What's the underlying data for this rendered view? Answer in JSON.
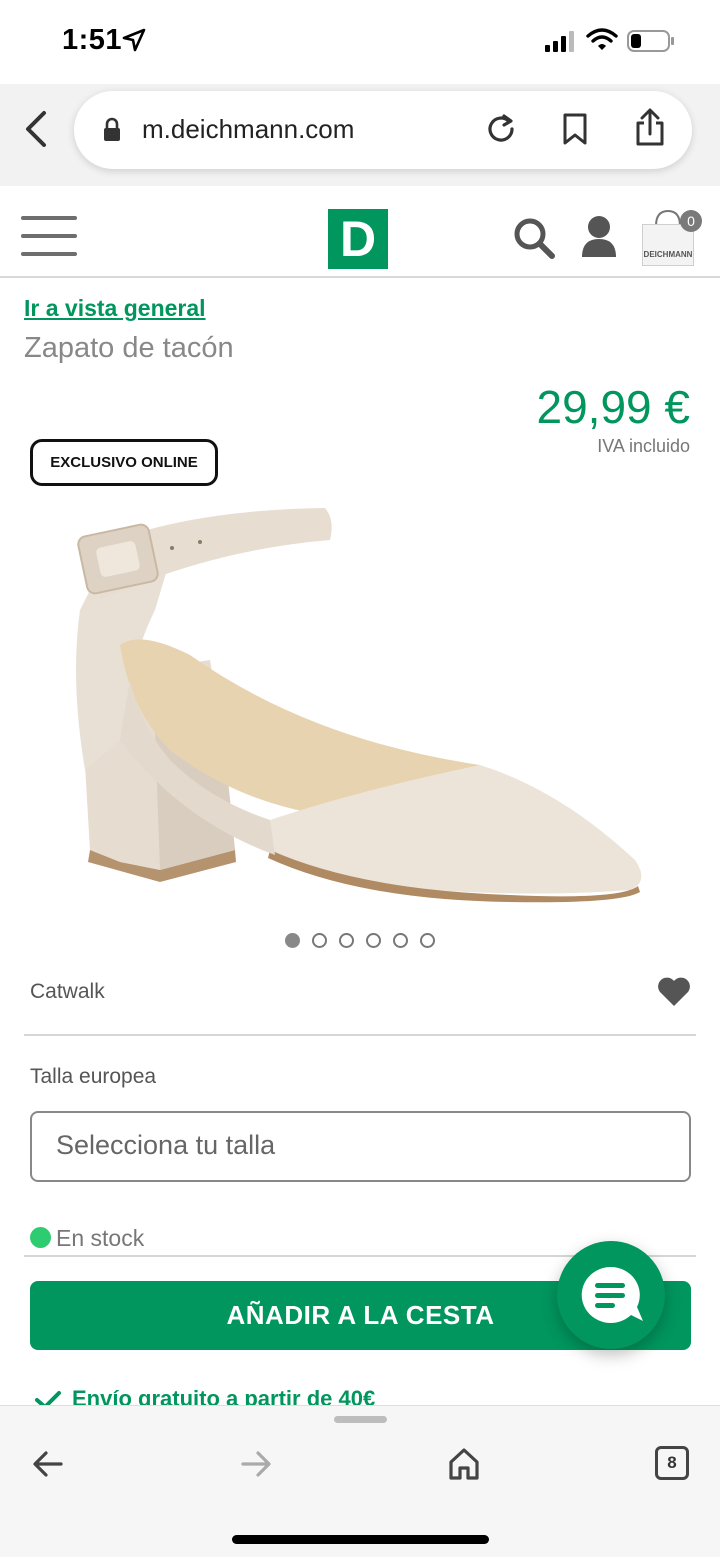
{
  "status_bar": {
    "time": "1:51"
  },
  "browser": {
    "url": "m.deichmann.com",
    "tab_count": "8"
  },
  "header": {
    "logo_letter": "D",
    "cart_count": "0",
    "cart_bag_label": "DEICHMANN"
  },
  "product": {
    "overview_link": "Ir a vista general",
    "type": "Zapato de tacón",
    "price": "29,99 €",
    "vat_note": "IVA incluido",
    "badge": "EXCLUSIVO ONLINE",
    "brand": "Catwalk",
    "image_count": 6,
    "active_image": 1
  },
  "size": {
    "label": "Talla europea",
    "placeholder": "Selecciona tu talla"
  },
  "stock": {
    "text": "En stock",
    "color": "#2ecc71"
  },
  "cta": {
    "add_to_cart": "AÑADIR A LA CESTA"
  },
  "shipping": {
    "text": "Envío gratuito a partir de 40€"
  },
  "colors": {
    "brand_green": "#00965e"
  },
  "icons": [
    "location-arrow-icon",
    "signal-icon",
    "wifi-icon",
    "battery-icon",
    "back-chevron-icon",
    "lock-icon",
    "reload-icon",
    "bookmark-icon",
    "share-icon",
    "hamburger-icon",
    "search-icon",
    "user-icon",
    "cart-icon",
    "heart-icon",
    "chat-icon",
    "check-icon",
    "arrow-left-icon",
    "arrow-right-icon",
    "home-icon"
  ]
}
